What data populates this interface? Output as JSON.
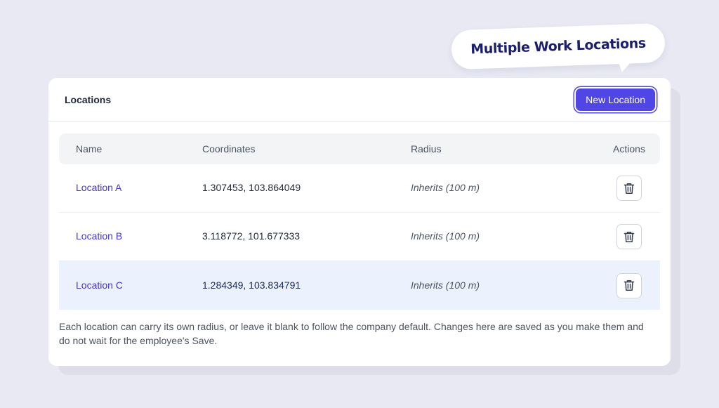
{
  "bubble": {
    "text": "Multiple Work Locations"
  },
  "card": {
    "title": "Locations",
    "new_button_label": "New Location"
  },
  "table": {
    "headers": {
      "name": "Name",
      "coordinates": "Coordinates",
      "radius": "Radius",
      "actions": "Actions"
    },
    "rows": [
      {
        "name": "Location A",
        "coordinates": "1.307453, 103.864049",
        "radius": "Inherits (100 m)",
        "action_icon": "trash-icon"
      },
      {
        "name": "Location B",
        "coordinates": "3.118772, 101.677333",
        "radius": "Inherits (100 m)",
        "action_icon": "trash-icon"
      },
      {
        "name": "Location C",
        "coordinates": "1.284349, 103.834791",
        "radius": "Inherits (100 m)",
        "action_icon": "trash-icon",
        "highlighted": true
      }
    ]
  },
  "note": "Each location can carry its own radius, or leave it blank to follow the company default. Changes here are saved as you make them and do not wait for the employee's Save.",
  "colors": {
    "accent": "#4f46e5",
    "link": "#4338ca",
    "highlight_row": "#ebf2fe",
    "page_background": "#e8e9f3"
  }
}
